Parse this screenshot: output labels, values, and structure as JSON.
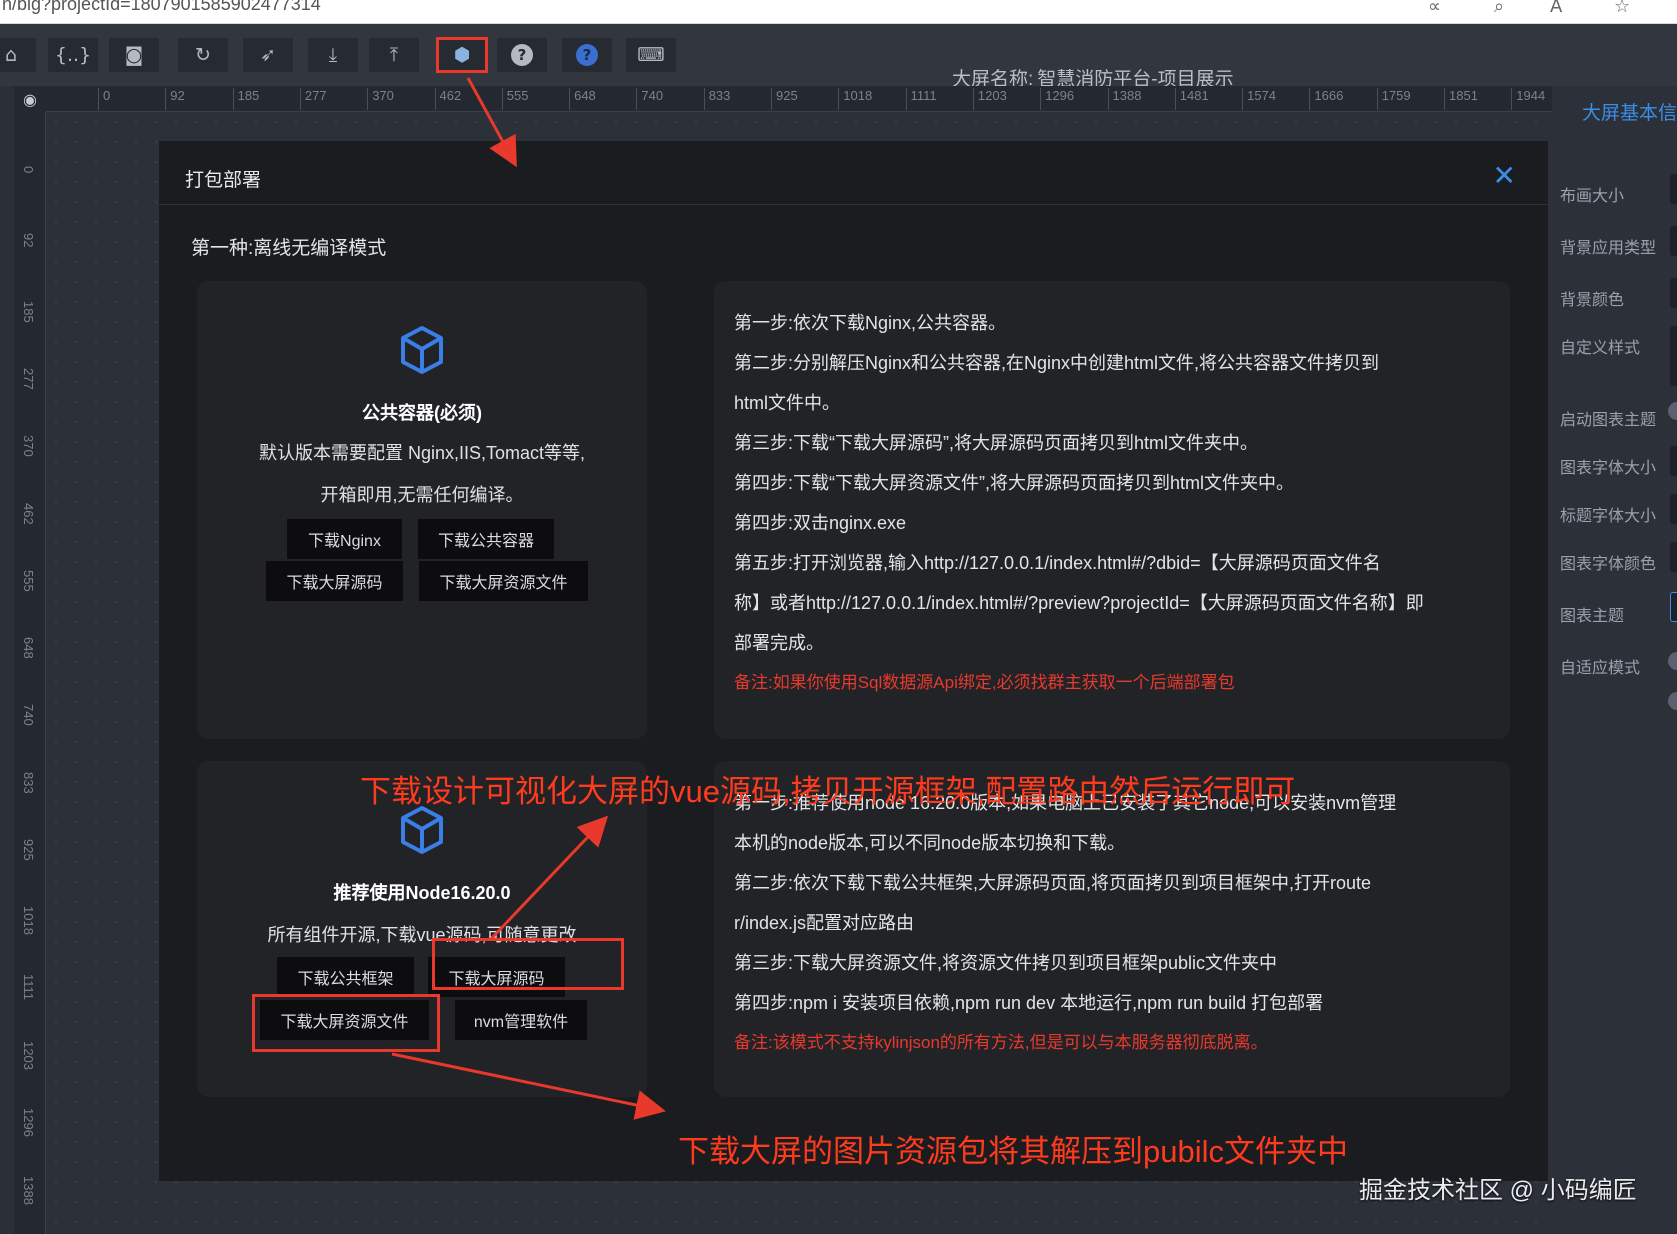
{
  "browser": {
    "url": "n/big?projectId=1807901585902477314"
  },
  "toolbar": {
    "screen_name_label": "大屏名称:",
    "screen_name_value": "智慧消防平台-项目展示",
    "tools": [
      {
        "name": "home-icon",
        "glyph": "⌂"
      },
      {
        "name": "code-icon",
        "glyph": "{..}"
      },
      {
        "name": "camera-icon",
        "glyph": "◙"
      },
      {
        "name": "refresh-icon",
        "glyph": "↻"
      },
      {
        "name": "rocket-icon",
        "glyph": "➶"
      },
      {
        "name": "download-icon",
        "glyph": "⤓"
      },
      {
        "name": "upload-icon",
        "glyph": "⤒"
      },
      {
        "name": "package-icon",
        "glyph": "⬢"
      },
      {
        "name": "help-icon",
        "glyph": "?"
      },
      {
        "name": "help-blue-icon",
        "glyph": "?"
      },
      {
        "name": "keyboard-icon",
        "glyph": "⌨"
      }
    ]
  },
  "ruler": {
    "top_ticks": [
      "0",
      "92",
      "185",
      "277",
      "370",
      "462",
      "555",
      "648",
      "740",
      "833",
      "925",
      "1018",
      "1111",
      "1203",
      "1296",
      "1388",
      "1481",
      "1574",
      "1666",
      "1759",
      "1851",
      "1944"
    ],
    "left_ticks": [
      "0",
      "92",
      "185",
      "277",
      "370",
      "462",
      "555",
      "648",
      "740",
      "833",
      "925",
      "1018",
      "1111",
      "1203",
      "1296",
      "1388"
    ]
  },
  "right_panel": {
    "title": "大屏基本信",
    "items": [
      "布画大小",
      "背景应用类型",
      "背景颜色",
      "自定义样式",
      "启动图表主题",
      "图表字体大小",
      "标题字体大小",
      "图表字体颜色",
      "图表主题",
      "自适应模式"
    ]
  },
  "modal": {
    "title": "打包部署",
    "section1_title": "第一种:离线无编译模式",
    "card1": {
      "heading": "公共容器(必须)",
      "desc_line1": "默认版本需要配置 Nginx,IIS,Tomact等等,",
      "desc_line2": "开箱即用,无需任何编译。",
      "buttons": [
        "下载Nginx",
        "下载公共容器",
        "下载大屏源码",
        "下载大屏资源文件"
      ]
    },
    "steps1": [
      "第一步:依次下载Nginx,公共容器。",
      "第二步:分别解压Nginx和公共容器,在Nginx中创建html文件,将公共容器文件拷贝到",
      "html文件中。",
      "第三步:下载“下载大屏源码”,将大屏源码页面拷贝到html文件夹中。",
      "第四步:下载“下载大屏资源文件”,将大屏源码页面拷贝到html文件夹中。",
      "第四步:双击nginx.exe",
      "第五步:打开浏览器,输入http://127.0.0.1/index.html#/?dbid=【大屏源码页面文件名",
      "称】或者http://127.0.0.1/index.html#/?preview?projectId=【大屏源码页面文件名称】即",
      "部署完成。"
    ],
    "note1": "备注:如果你使用Sql数据源Api绑定,必须找群主获取一个后端部署包",
    "card2": {
      "heading": "推荐使用Node16.20.0",
      "desc": "所有组件开源,下载vue源码,可随意更改",
      "buttons": [
        "下载公共框架",
        "下载大屏源码",
        "下载大屏资源文件",
        "nvm管理软件"
      ]
    },
    "steps2": [
      "第一步:推荐使用node 16.20.0版本,如果电脑上已安装了其它node,可以安装nvm管理",
      "本机的node版本,可以不同node版本切换和下载。",
      "第二步:依次下载下载公共框架,大屏源码页面,将页面拷贝到项目框架中,打开route",
      "r/index.js配置对应路由",
      "第三步:下载大屏资源文件,将资源文件拷贝到项目框架public文件夹中",
      "第四步:npm i 安装项目依赖,npm run dev 本地运行,npm run build 打包部署"
    ],
    "note2": "备注:该模式不支持kylinjson的所有方法,但是可以与本服务器彻底脱离。"
  },
  "annotations": {
    "top": "下载设计可视化大屏的vue源码,拷贝开源框架,配置路由然后运行即可",
    "bottom": "下载大屏的图片资源包将其解压到pubilc文件夹中"
  },
  "watermark": "掘金技术社区 @ 小码编匠",
  "colors": {
    "accent_blue": "#3a8ee6",
    "annotation_red": "#e8392c",
    "modal_bg": "#1b1c1f"
  }
}
